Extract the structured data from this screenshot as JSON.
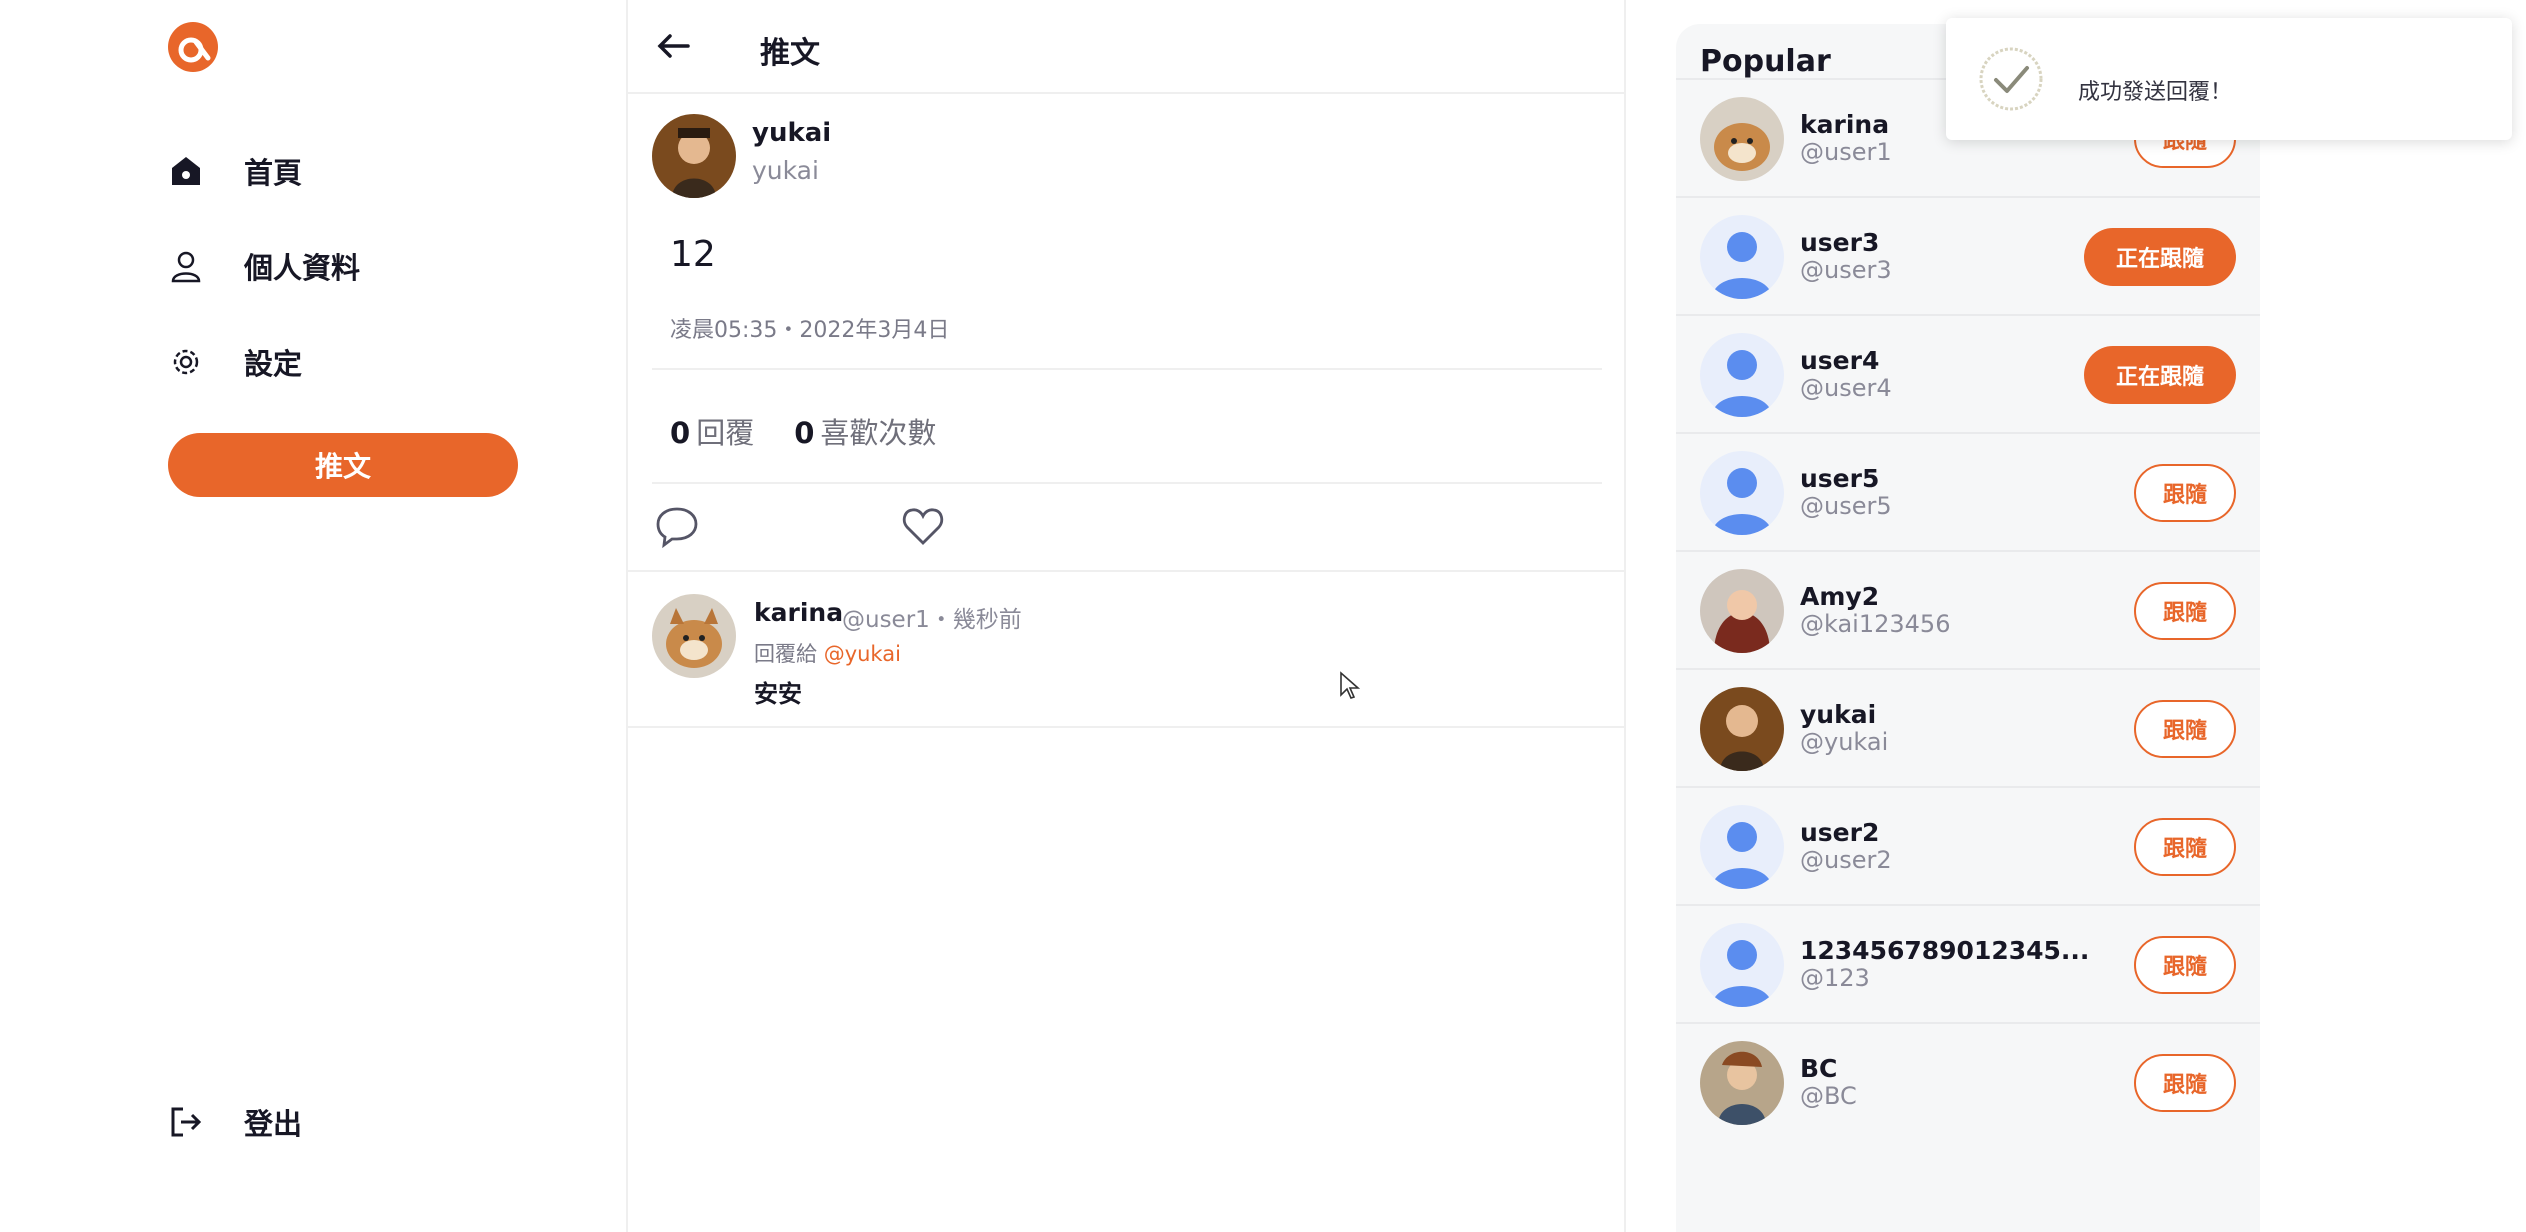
{
  "colors": {
    "accent": "#e8662a",
    "avatar_default": "#5b8def"
  },
  "nav": {
    "items": [
      {
        "label": "首頁",
        "icon": "home-icon"
      },
      {
        "label": "個人資料",
        "icon": "user-icon"
      },
      {
        "label": "設定",
        "icon": "gear-icon"
      }
    ],
    "tweet_button": "推文",
    "logout": {
      "label": "登出",
      "icon": "logout-icon"
    }
  },
  "header": {
    "title": "推文"
  },
  "tweet": {
    "author_name": "yukai",
    "author_handle": "yukai",
    "content": "12",
    "time": "凌晨05:35・2022年3月4日",
    "reply_count": "0",
    "reply_label": "回覆",
    "like_count": "0",
    "like_label": "喜歡次數"
  },
  "reply": {
    "name": "karina",
    "meta": "@user1・幾秒前",
    "reply_to_prefix": "回覆給",
    "reply_to_handle": "@yukai",
    "text": "安安"
  },
  "popular": {
    "title": "Popular",
    "users": [
      {
        "name": "karina",
        "handle": "@user1",
        "button": "跟隨",
        "following": false,
        "avatar": "dog"
      },
      {
        "name": "user3",
        "handle": "@user3",
        "button": "正在跟隨",
        "following": true,
        "avatar": "default"
      },
      {
        "name": "user4",
        "handle": "@user4",
        "button": "正在跟隨",
        "following": true,
        "avatar": "default"
      },
      {
        "name": "user5",
        "handle": "@user5",
        "button": "跟隨",
        "following": false,
        "avatar": "default"
      },
      {
        "name": "Amy2",
        "handle": "@kai123456",
        "button": "跟隨",
        "following": false,
        "avatar": "photo"
      },
      {
        "name": "yukai",
        "handle": "@yukai",
        "button": "跟隨",
        "following": false,
        "avatar": "photo"
      },
      {
        "name": "user2",
        "handle": "@user2",
        "button": "跟隨",
        "following": false,
        "avatar": "default"
      },
      {
        "name": "123456789012345...",
        "handle": "@123",
        "button": "跟隨",
        "following": false,
        "avatar": "default"
      },
      {
        "name": "BC",
        "handle": "@BC",
        "button": "跟隨",
        "following": false,
        "avatar": "photo"
      }
    ]
  },
  "toast": {
    "message": "成功發送回覆！",
    "icon": "check-icon"
  }
}
